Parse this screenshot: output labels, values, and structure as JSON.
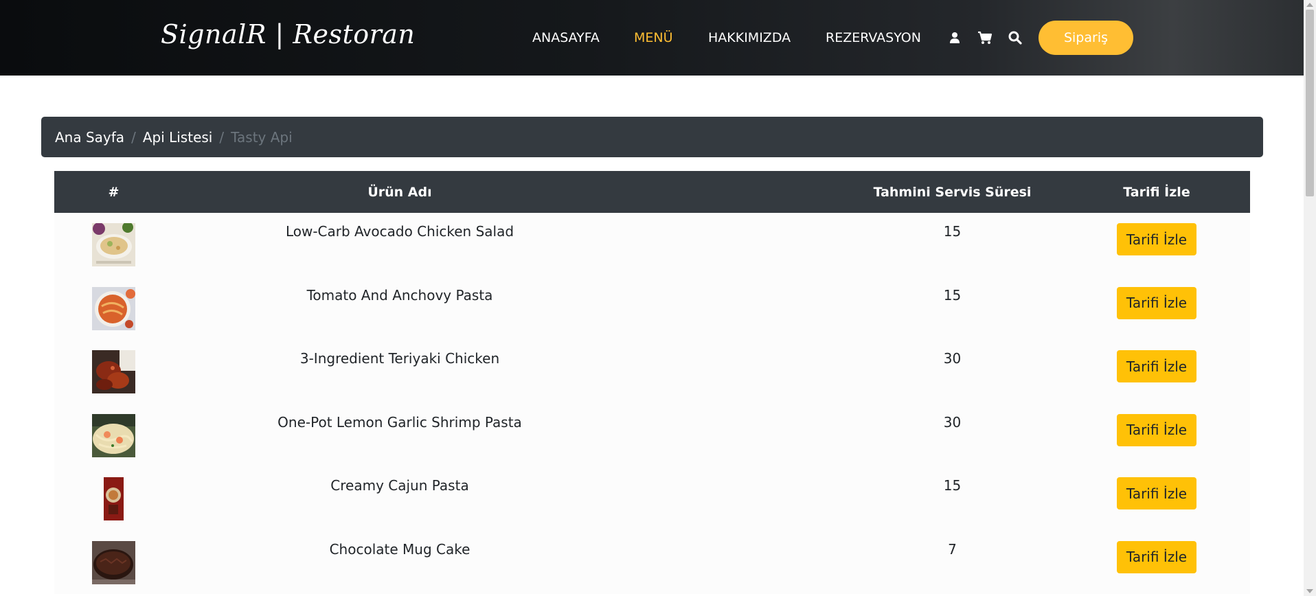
{
  "header": {
    "logo": "SignalR | Restoran",
    "nav": [
      "ANASAYFA",
      "MENÜ",
      "HAKKIMIZDA",
      "REZERVASYON"
    ],
    "order_button": "Sipariş",
    "icons": [
      "user-icon",
      "cart-icon",
      "search-icon"
    ],
    "accent_color": "#ffbe33"
  },
  "breadcrumb": {
    "items": [
      "Ana Sayfa",
      "Api Listesi"
    ],
    "active": "Tasty Api"
  },
  "table": {
    "headers": [
      "#",
      "Ürün Adı",
      "Tahmini Servis Süresi",
      "Tarifi İzle"
    ],
    "rows": [
      {
        "name": "Low-Carb Avocado Chicken Salad",
        "time": "15",
        "button": "Tarifi İzle"
      },
      {
        "name": "Tomato And Anchovy Pasta",
        "time": "15",
        "button": "Tarifi İzle"
      },
      {
        "name": "3-Ingredient Teriyaki Chicken",
        "time": "30",
        "button": "Tarifi İzle"
      },
      {
        "name": "One-Pot Lemon Garlic Shrimp Pasta",
        "time": "30",
        "button": "Tarifi İzle"
      },
      {
        "name": "Creamy Cajun Pasta",
        "time": "15",
        "button": "Tarifi İzle"
      },
      {
        "name": "Chocolate Mug Cake",
        "time": "7",
        "button": "Tarifi İzle"
      }
    ]
  }
}
